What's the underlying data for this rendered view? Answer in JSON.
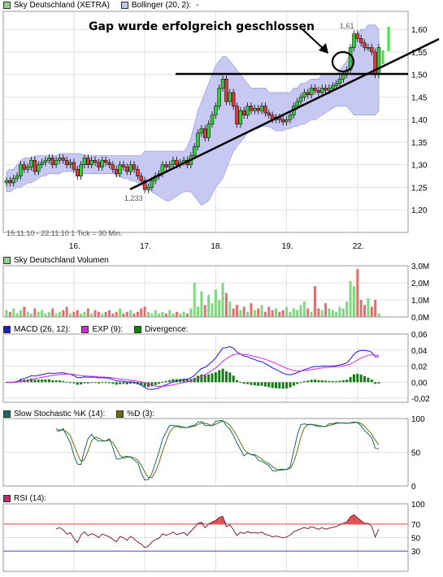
{
  "price_panel": {
    "legend": [
      {
        "label": "Sky Deutschland (XETRA)",
        "color": "#8ad58a"
      },
      {
        "label": "Bollinger (20, 2):",
        "color": "#bfc3ee"
      },
      {
        "label": "-",
        "color": null
      }
    ],
    "period_text": "15.11.10 - 22.11.10   1 Tick = 30 Min.",
    "annotation": "Gap wurde erfolgreich geschlossen",
    "low_label": "1,233",
    "high_label": "1,61"
  },
  "volume_panel": {
    "legend": [
      {
        "label": "Sky Deutschland Volumen",
        "color": "#8ad58a"
      }
    ]
  },
  "macd_panel": {
    "legend": [
      {
        "label": "MACD (26, 12):",
        "color": "#1a1ad6"
      },
      {
        "label": "EXP (9):",
        "color": "#e020e0"
      },
      {
        "label": "Divergence:",
        "color": "#137d13"
      }
    ]
  },
  "stoch_panel": {
    "legend": [
      {
        "label": "Slow Stochastic %K (14):",
        "color": "#136b6b"
      },
      {
        "label": "%D (3):",
        "color": "#6b6b13"
      }
    ]
  },
  "rsi_panel": {
    "legend": [
      {
        "label": "RSI (14):",
        "color": "#c02a6b"
      }
    ]
  },
  "colors": {
    "up": "#38c938",
    "down": "#d63a3a",
    "band": "#c7c9f3",
    "grid": "#e2e2e2"
  },
  "chart_data": [
    {
      "type": "candlestick",
      "title": "Sky Deutschland (XETRA)",
      "x_ticks": [
        "16.",
        "17.",
        "18.",
        "19.",
        "22."
      ],
      "y_ticks": [
        "1,20",
        "1,25",
        "1,30",
        "1,35",
        "1,40",
        "1,45",
        "1,50",
        "1,55",
        "1,60"
      ],
      "ylim": [
        1.15,
        1.64
      ],
      "close": [
        1.265,
        1.26,
        1.27,
        1.275,
        1.3,
        1.29,
        1.295,
        1.31,
        1.285,
        1.3,
        1.305,
        1.31,
        1.315,
        1.3,
        1.31,
        1.315,
        1.31,
        1.3,
        1.305,
        1.29,
        1.275,
        1.3,
        1.315,
        1.3,
        1.31,
        1.305,
        1.295,
        1.31,
        1.305,
        1.3,
        1.29,
        1.28,
        1.3,
        1.295,
        1.285,
        1.3,
        1.29,
        1.275,
        1.265,
        1.245,
        1.25,
        1.265,
        1.275,
        1.28,
        1.3,
        1.295,
        1.3,
        1.31,
        1.3,
        1.305,
        1.31,
        1.3,
        1.32,
        1.34,
        1.37,
        1.38,
        1.36,
        1.39,
        1.41,
        1.43,
        1.47,
        1.49,
        1.44,
        1.46,
        1.43,
        1.39,
        1.42,
        1.41,
        1.43,
        1.42,
        1.425,
        1.42,
        1.43,
        1.415,
        1.41,
        1.4,
        1.405,
        1.4,
        1.395,
        1.4,
        1.41,
        1.43,
        1.44,
        1.45,
        1.46,
        1.455,
        1.47,
        1.465,
        1.46,
        1.47,
        1.465,
        1.47,
        1.475,
        1.48,
        1.49,
        1.5,
        1.51,
        1.56,
        1.59,
        1.58,
        1.57,
        1.56,
        1.56,
        1.55,
        1.5,
        1.56
      ],
      "bollinger_upper": [
        1.285,
        1.29,
        1.29,
        1.3,
        1.31,
        1.315,
        1.315,
        1.315,
        1.32,
        1.32,
        1.32,
        1.32,
        1.32,
        1.32,
        1.32,
        1.325,
        1.325,
        1.325,
        1.325,
        1.325,
        1.325,
        1.325,
        1.32,
        1.32,
        1.32,
        1.32,
        1.32,
        1.32,
        1.32,
        1.32,
        1.32,
        1.32,
        1.32,
        1.32,
        1.32,
        1.32,
        1.32,
        1.32,
        1.32,
        1.33,
        1.33,
        1.33,
        1.33,
        1.33,
        1.33,
        1.33,
        1.33,
        1.33,
        1.33,
        1.33,
        1.33,
        1.34,
        1.36,
        1.39,
        1.42,
        1.44,
        1.46,
        1.48,
        1.5,
        1.52,
        1.53,
        1.54,
        1.54,
        1.53,
        1.52,
        1.51,
        1.5,
        1.49,
        1.48,
        1.47,
        1.47,
        1.47,
        1.47,
        1.47,
        1.46,
        1.46,
        1.46,
        1.46,
        1.46,
        1.46,
        1.46,
        1.47,
        1.47,
        1.48,
        1.48,
        1.485,
        1.49,
        1.49,
        1.49,
        1.5,
        1.5,
        1.5,
        1.5,
        1.5,
        1.51,
        1.52,
        1.53,
        1.55,
        1.58,
        1.59,
        1.6,
        1.6,
        1.61,
        1.61,
        1.61,
        1.6
      ],
      "bollinger_lower": [
        1.24,
        1.24,
        1.245,
        1.25,
        1.25,
        1.255,
        1.26,
        1.26,
        1.265,
        1.27,
        1.275,
        1.275,
        1.28,
        1.28,
        1.28,
        1.28,
        1.285,
        1.285,
        1.285,
        1.285,
        1.285,
        1.28,
        1.28,
        1.28,
        1.28,
        1.28,
        1.28,
        1.28,
        1.28,
        1.28,
        1.28,
        1.275,
        1.275,
        1.27,
        1.27,
        1.265,
        1.265,
        1.26,
        1.255,
        1.25,
        1.245,
        1.24,
        1.235,
        1.23,
        1.225,
        1.22,
        1.22,
        1.225,
        1.23,
        1.235,
        1.24,
        1.24,
        1.24,
        1.23,
        1.22,
        1.21,
        1.215,
        1.22,
        1.235,
        1.25,
        1.26,
        1.27,
        1.29,
        1.31,
        1.33,
        1.34,
        1.35,
        1.36,
        1.37,
        1.375,
        1.38,
        1.38,
        1.385,
        1.385,
        1.385,
        1.38,
        1.375,
        1.375,
        1.375,
        1.38,
        1.38,
        1.385,
        1.385,
        1.39,
        1.39,
        1.395,
        1.4,
        1.4,
        1.405,
        1.41,
        1.415,
        1.42,
        1.425,
        1.43,
        1.43,
        1.43,
        1.43,
        1.42,
        1.41,
        1.41,
        1.41,
        1.41,
        1.41,
        1.41,
        1.41,
        1.42
      ],
      "annotations": [
        "Gap wurde erfolgreich geschlossen",
        "1,233",
        "1,61"
      ]
    },
    {
      "type": "bar",
      "title": "Sky Deutschland Volumen",
      "y_ticks": [
        "0,0M",
        "1,0M",
        "2,0M",
        "3,0M"
      ],
      "ylim": [
        0,
        3.0
      ],
      "values_m": [
        0.4,
        0.3,
        0.5,
        0.2,
        0.4,
        0.6,
        0.3,
        0.2,
        0.5,
        0.3,
        0.4,
        0.2,
        0.3,
        0.5,
        0.2,
        0.3,
        0.4,
        0.6,
        0.2,
        0.3,
        0.4,
        0.2,
        0.3,
        0.5,
        0.2,
        0.4,
        0.3,
        0.2,
        0.3,
        0.4,
        0.2,
        0.3,
        0.5,
        0.2,
        0.3,
        0.4,
        0.2,
        0.3,
        0.5,
        0.6,
        0.3,
        0.2,
        0.4,
        0.2,
        0.3,
        0.2,
        0.4,
        0.2,
        0.3,
        0.2,
        0.3,
        0.2,
        0.5,
        2.0,
        0.6,
        1.5,
        0.7,
        1.3,
        0.8,
        1.6,
        1.0,
        2.0,
        1.4,
        0.9,
        0.5,
        0.7,
        0.4,
        0.6,
        0.3,
        0.8,
        0.4,
        0.5,
        0.7,
        0.3,
        0.6,
        0.4,
        0.5,
        0.3,
        0.4,
        0.6,
        0.3,
        0.5,
        0.4,
        0.7,
        0.9,
        0.5,
        0.3,
        1.8,
        0.5,
        0.4,
        0.8,
        0.5,
        0.4,
        0.3,
        0.6,
        0.5,
        0.9,
        2.1,
        1.8,
        2.8,
        1.0,
        0.7,
        1.1,
        0.6,
        1.0,
        0.2
      ]
    },
    {
      "type": "line",
      "title": "MACD (26, 12)",
      "y_ticks": [
        "-0,02",
        "0,00",
        "0,02",
        "0,04",
        "0,06"
      ],
      "ylim": [
        -0.025,
        0.06
      ],
      "series": [
        "MACD (26, 12):",
        "EXP (9):",
        "Divergence:"
      ]
    },
    {
      "type": "line",
      "title": "Slow Stochastic %K (14)",
      "y_ticks": [
        "0",
        "50",
        "100"
      ],
      "ylim": [
        0,
        100
      ]
    },
    {
      "type": "line",
      "title": "RSI (14)",
      "y_ticks": [
        "30",
        "50",
        "70",
        "100"
      ],
      "ylim": [
        0,
        100
      ],
      "levels": [
        30,
        70
      ]
    }
  ]
}
